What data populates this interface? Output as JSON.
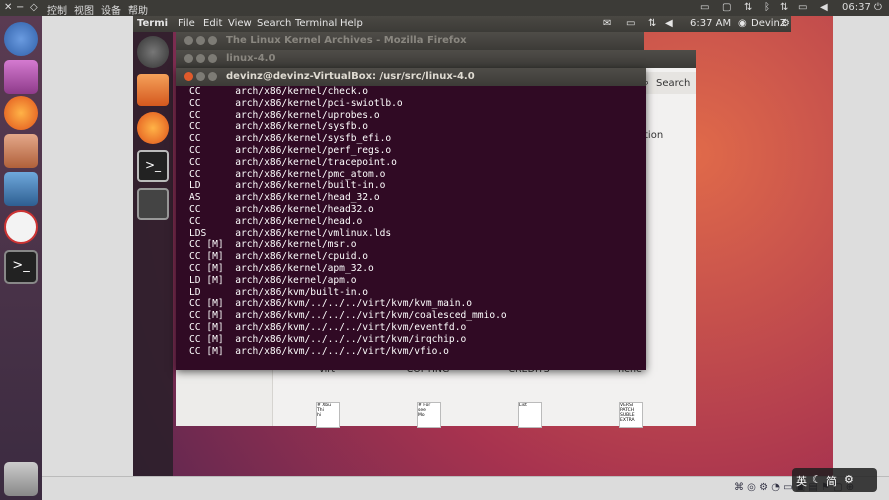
{
  "host": {
    "menu": [
      "控制",
      "视图",
      "设备",
      "帮助"
    ],
    "clock": "06:37"
  },
  "guest_panel": {
    "app_name": "Termi",
    "menu": [
      "File",
      "Edit",
      "View",
      "Search",
      "Terminal",
      "Help"
    ],
    "time": "6:37 AM",
    "user": "DevinZ"
  },
  "firefox": {
    "title": "The Linux Kernel Archives - Mozilla Firefox"
  },
  "files_window": {
    "title": "linux-4.0",
    "search_label": "Search",
    "partial_text": "tion",
    "items": [
      "virt",
      "COPYING",
      "CREDITS",
      "hehe"
    ],
    "doc_snippets": [
      "serf\nof t",
      "forma\nscrip",
      "# Xbu\nThi\nhi",
      "# For\nsee\nMo",
      "List",
      "VERSI\nPATCH\nSUBLE\nEXTRA"
    ]
  },
  "terminal": {
    "title": "devinz@devinz-VirtualBox: /usr/src/linux-4.0",
    "lines": [
      "CC      arch/x86/kernel/check.o",
      "CC      arch/x86/kernel/pci-swiotlb.o",
      "CC      arch/x86/kernel/uprobes.o",
      "CC      arch/x86/kernel/sysfb.o",
      "CC      arch/x86/kernel/sysfb_efi.o",
      "CC      arch/x86/kernel/perf_regs.o",
      "CC      arch/x86/kernel/tracepoint.o",
      "CC      arch/x86/kernel/pmc_atom.o",
      "LD      arch/x86/kernel/built-in.o",
      "AS      arch/x86/kernel/head_32.o",
      "CC      arch/x86/kernel/head32.o",
      "CC      arch/x86/kernel/head.o",
      "LDS     arch/x86/kernel/vmlinux.lds",
      "CC [M]  arch/x86/kernel/msr.o",
      "CC [M]  arch/x86/kernel/cpuid.o",
      "CC [M]  arch/x86/kernel/apm_32.o",
      "LD [M]  arch/x86/kernel/apm.o",
      "LD      arch/x86/kvm/built-in.o",
      "CC [M]  arch/x86/kvm/../../../virt/kvm/kvm_main.o",
      "CC [M]  arch/x86/kvm/../../../virt/kvm/coalesced_mmio.o",
      "CC [M]  arch/x86/kvm/../../../virt/kvm/eventfd.o",
      "CC [M]  arch/x86/kvm/../../../virt/kvm/irqchip.o",
      "CC [M]  arch/x86/kvm/../../../virt/kvm/vfio.o"
    ]
  },
  "ime": {
    "lang": "英",
    "mode": "简"
  }
}
